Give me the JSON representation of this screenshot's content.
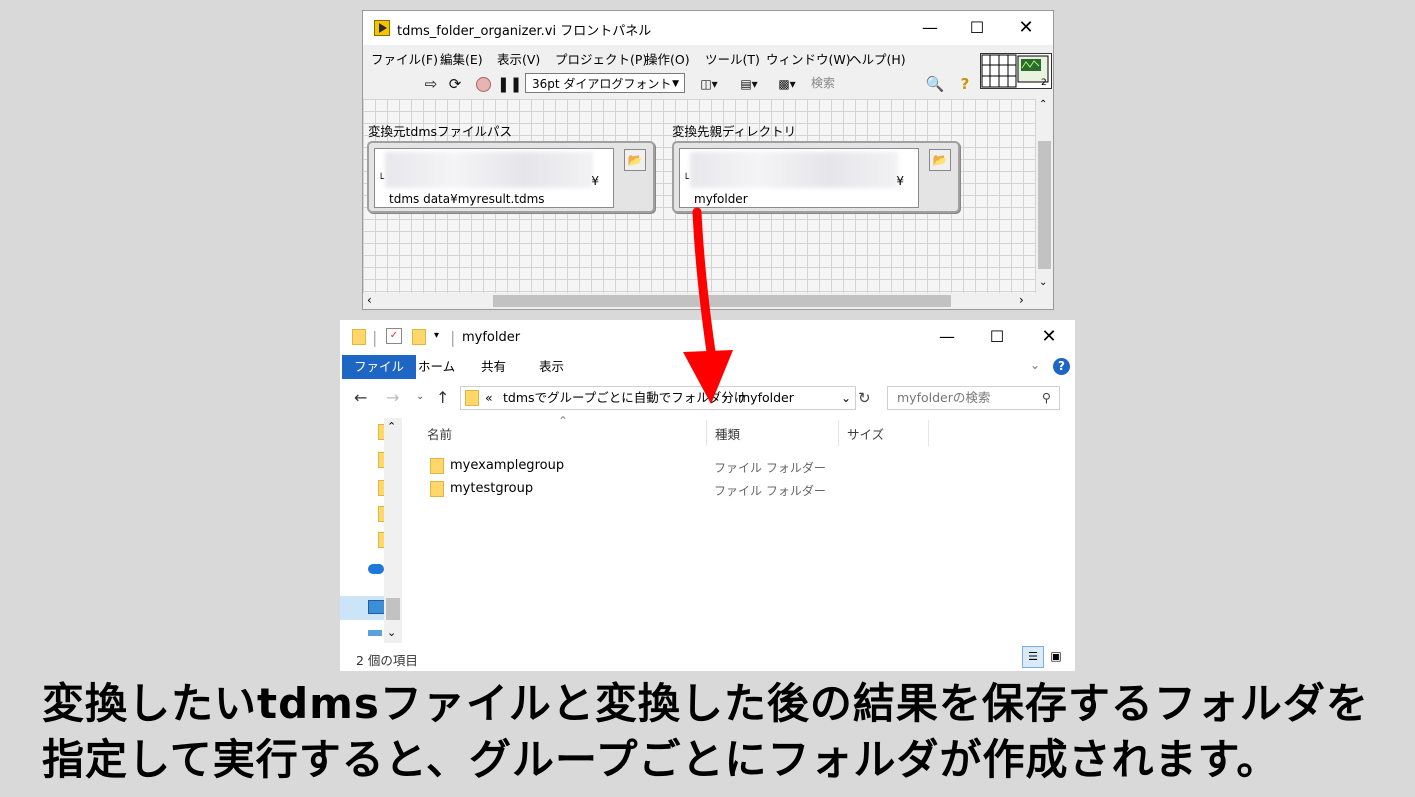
{
  "labview": {
    "title": "tdms_folder_organizer.vi フロントパネル",
    "menu": [
      "ファイル(F)",
      "編集(E)",
      "表示(V)",
      "プロジェクト(P)",
      "操作(O)",
      "ツール(T)",
      "ウィンドウ(W)",
      "ヘルプ(H)"
    ],
    "font_select": "36pt ダイアログフォント",
    "search_placeholder": "検索",
    "help_glyph": "?",
    "source_label": "変換元tdmsファイルパス",
    "source_value": "tdms data¥myresult.tdms",
    "source_yen": "¥",
    "dest_label": "変換先親ディレクトリ",
    "dest_value": "myfolder",
    "dest_yen": "¥",
    "icon_terminal_count": "2"
  },
  "explorer": {
    "title": "myfolder",
    "ribbon_tabs": [
      "ファイル",
      "ホーム",
      "共有",
      "表示"
    ],
    "address": {
      "prefix": "«",
      "parent": "tdmsでグループごとに自動でフォルダ分け",
      "separator": "›",
      "current": "myfolder"
    },
    "search_placeholder": "myfolderの検索",
    "columns": {
      "name": "名前",
      "type": "種類",
      "size": "サイズ"
    },
    "rows": [
      {
        "name": "myexamplegroup",
        "type": "ファイル フォルダー"
      },
      {
        "name": "mytestgroup",
        "type": "ファイル フォルダー"
      }
    ],
    "status": "2 個の項目"
  },
  "caption": {
    "line1": "変換したいtdmsファイルと変換した後の結果を保存するフォルダを",
    "line2": "指定して実行すると、グループごとにフォルダが作成されます。"
  },
  "colors": {
    "arrow": "#ff0000",
    "ribbon_active": "#1e66c4",
    "folder": "#ffd76a"
  }
}
